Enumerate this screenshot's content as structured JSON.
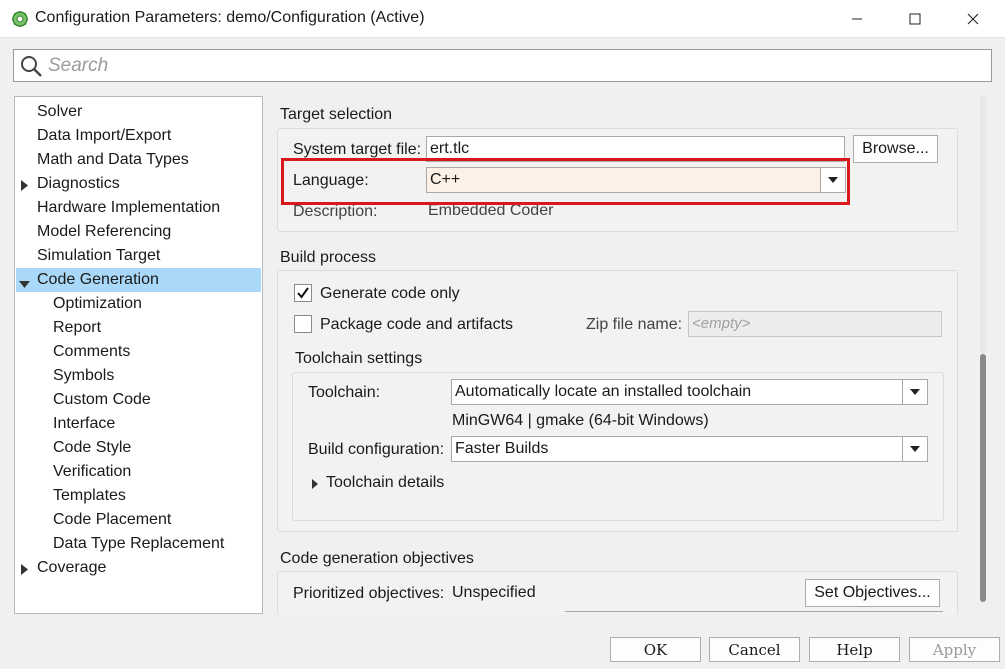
{
  "window": {
    "title": "Configuration Parameters: demo/Configuration (Active)",
    "controls": {
      "minimize": "minimize",
      "maximize": "maximize",
      "close": "close"
    }
  },
  "search": {
    "placeholder": "Search",
    "value": ""
  },
  "tree": {
    "items": [
      {
        "label": "Solver",
        "level": 0,
        "expandable": false,
        "selected": false
      },
      {
        "label": "Data Import/Export",
        "level": 0,
        "expandable": false,
        "selected": false
      },
      {
        "label": "Math and Data Types",
        "level": 0,
        "expandable": false,
        "selected": false
      },
      {
        "label": "Diagnostics",
        "level": 0,
        "expandable": true,
        "expanded": false,
        "selected": false
      },
      {
        "label": "Hardware Implementation",
        "level": 0,
        "expandable": false,
        "selected": false
      },
      {
        "label": "Model Referencing",
        "level": 0,
        "expandable": false,
        "selected": false
      },
      {
        "label": "Simulation Target",
        "level": 0,
        "expandable": false,
        "selected": false
      },
      {
        "label": "Code Generation",
        "level": 0,
        "expandable": true,
        "expanded": true,
        "selected": true
      },
      {
        "label": "Optimization",
        "level": 1,
        "expandable": false,
        "selected": false
      },
      {
        "label": "Report",
        "level": 1,
        "expandable": false,
        "selected": false
      },
      {
        "label": "Comments",
        "level": 1,
        "expandable": false,
        "selected": false
      },
      {
        "label": "Symbols",
        "level": 1,
        "expandable": false,
        "selected": false
      },
      {
        "label": "Custom Code",
        "level": 1,
        "expandable": false,
        "selected": false
      },
      {
        "label": "Interface",
        "level": 1,
        "expandable": false,
        "selected": false
      },
      {
        "label": "Code Style",
        "level": 1,
        "expandable": false,
        "selected": false
      },
      {
        "label": "Verification",
        "level": 1,
        "expandable": false,
        "selected": false
      },
      {
        "label": "Templates",
        "level": 1,
        "expandable": false,
        "selected": false
      },
      {
        "label": "Code Placement",
        "level": 1,
        "expandable": false,
        "selected": false
      },
      {
        "label": "Data Type Replacement",
        "level": 1,
        "expandable": false,
        "selected": false
      },
      {
        "label": "Coverage",
        "level": 0,
        "expandable": true,
        "expanded": false,
        "selected": false
      }
    ]
  },
  "target_selection": {
    "title": "Target selection",
    "system_target_file_label": "System target file:",
    "system_target_file_value": "ert.tlc",
    "browse_label": "Browse...",
    "language_label": "Language:",
    "language_value": "C++",
    "description_label": "Description:",
    "description_value": "Embedded Coder"
  },
  "build_process": {
    "title": "Build process",
    "generate_code_only_label": "Generate code only",
    "generate_code_only_checked": true,
    "package_code_label": "Package code and artifacts",
    "package_code_checked": false,
    "zip_file_label": "Zip file name:",
    "zip_file_placeholder": "<empty>",
    "toolchain_settings": {
      "title": "Toolchain settings",
      "toolchain_label": "Toolchain:",
      "toolchain_value": "Automatically locate an installed toolchain",
      "toolchain_info": "MinGW64 | gmake (64-bit Windows)",
      "build_config_label": "Build configuration:",
      "build_config_value": "Faster Builds",
      "details_label": "Toolchain details"
    }
  },
  "objectives": {
    "title": "Code generation objectives",
    "prioritized_label": "Prioritized objectives:",
    "prioritized_value": "Unspecified",
    "set_objectives_label": "Set Objectives..."
  },
  "footer": {
    "ok": "OK",
    "cancel": "Cancel",
    "help": "Help",
    "apply": "Apply"
  },
  "colors": {
    "selection": "#a9d8f8",
    "highlight_box": "#d9181e",
    "language_field_bg": "#fdf0e6"
  }
}
